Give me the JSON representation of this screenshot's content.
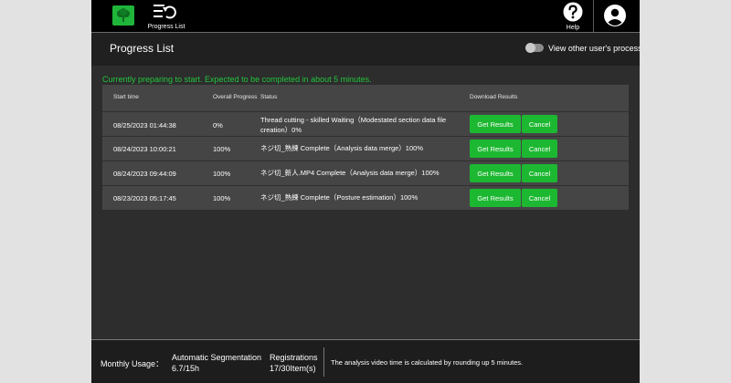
{
  "nav": {
    "progress_list_label": "Progress List",
    "help_label": "Help"
  },
  "icons": {
    "logo": "tree-logo-icon",
    "progress_list": "list-refresh-icon",
    "help": "help-circle-icon",
    "account": "account-circle-icon"
  },
  "page": {
    "title": "Progress List",
    "toggle_label": "View other user's process",
    "toggle_on": false
  },
  "notice": "Currently preparing to start. Expected to be completed in about 5 minutes.",
  "table": {
    "headers": {
      "start_time": "Start time",
      "overall_progress": "Overall Progress",
      "status": "Status",
      "download": "Download Results"
    },
    "rows": [
      {
        "start_time": "08/25/2023 01:44:38",
        "progress": "0%",
        "status": "Thread cutting - skilled Waiting（Modestated section data file creation）0%",
        "get_label": "Get Results",
        "cancel_label": "Cancel"
      },
      {
        "start_time": "08/24/2023 10:00:21",
        "progress": "100%",
        "status": "ネジ切_熟練 Complete（Analysis data merge）100%",
        "get_label": "Get Results",
        "cancel_label": "Cancel"
      },
      {
        "start_time": "08/24/2023 09:44:09",
        "progress": "100%",
        "status": "ネジ切_新人.MP4 Complete（Analysis data merge）100%",
        "get_label": "Get Results",
        "cancel_label": "Cancel"
      },
      {
        "start_time": "08/23/2023 05:17:45",
        "progress": "100%",
        "status": "ネジ切_熟練 Complete（Posture estimation）100%",
        "get_label": "Get Results",
        "cancel_label": "Cancel"
      }
    ]
  },
  "footer": {
    "monthly_usage_label": "Monthly Usage：",
    "auto_seg_label": "Automatic Segmentation",
    "auto_seg_value": "6.7/15h",
    "registrations_label": "Registrations",
    "registrations_value": "17/30Item(s)",
    "note": "The analysis video time is calculated by rounding up 5 minutes."
  },
  "colors": {
    "accent_green": "#1db832",
    "notice_green": "#22c53c",
    "background": "#2d2d2d"
  }
}
